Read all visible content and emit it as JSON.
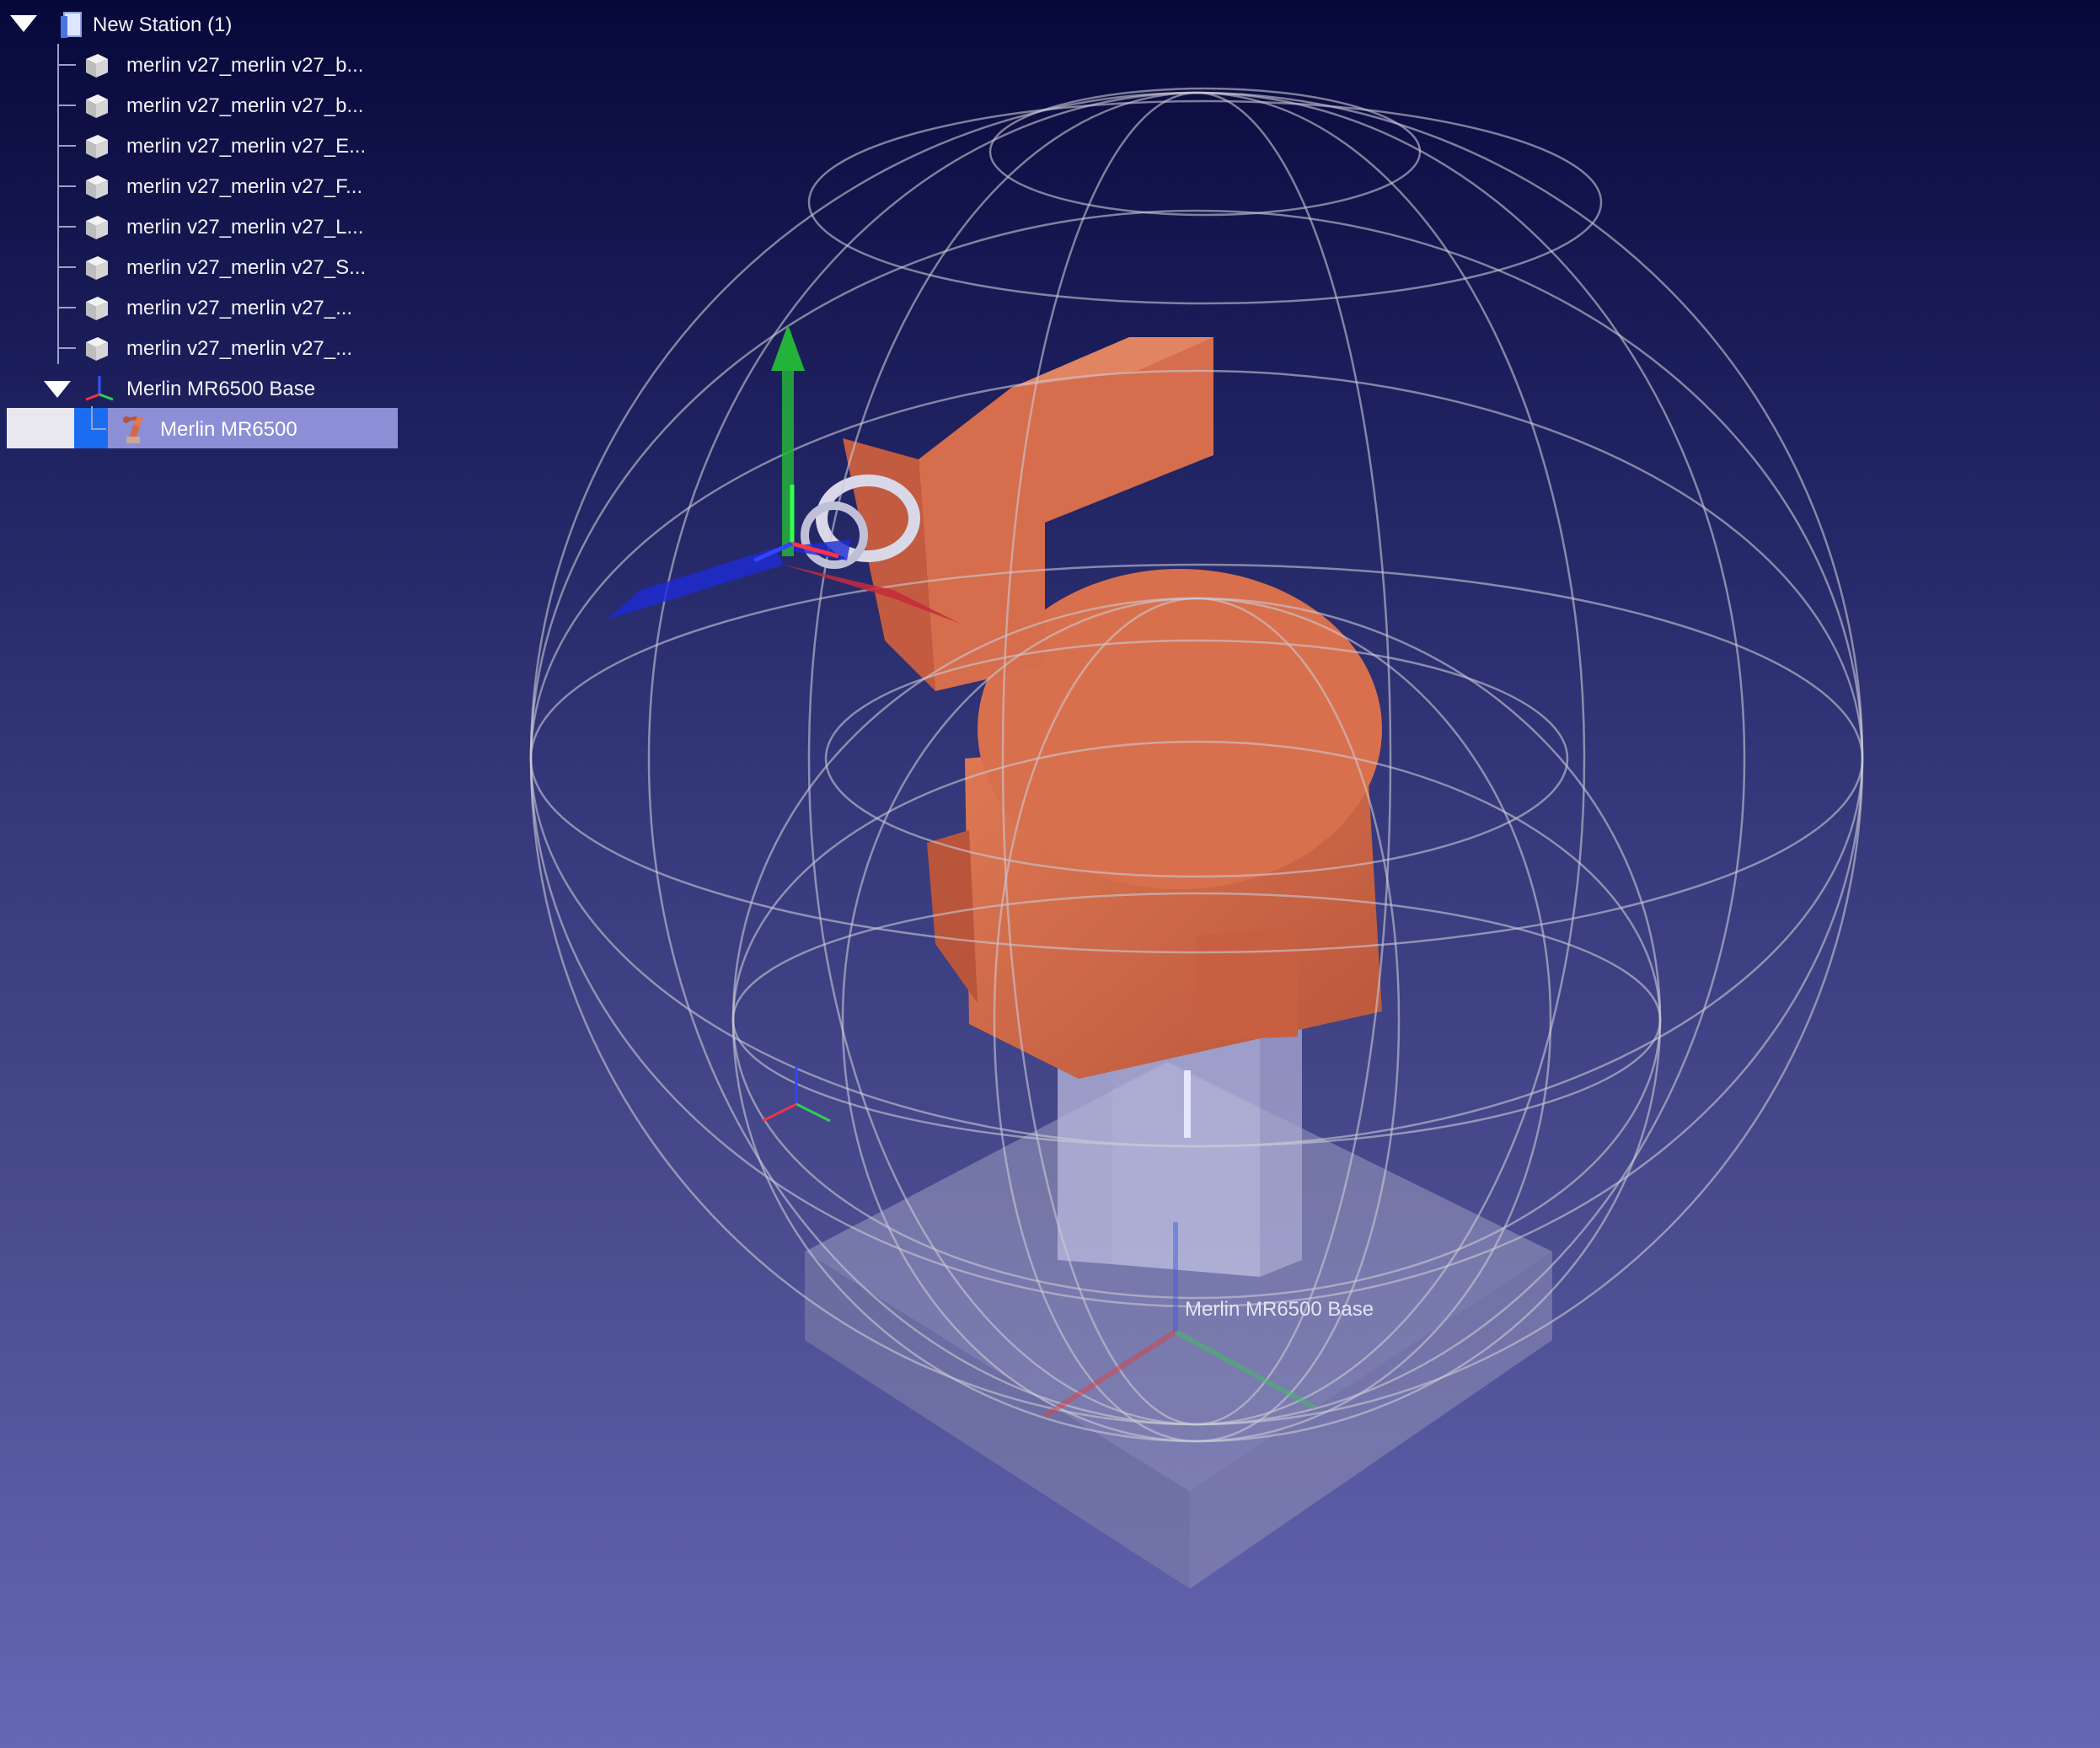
{
  "station": {
    "title": "New Station (1)"
  },
  "parts": [
    {
      "label": "merlin v27_merlin v27_b..."
    },
    {
      "label": "merlin v27_merlin v27_b..."
    },
    {
      "label": "merlin v27_merlin v27_E..."
    },
    {
      "label": "merlin v27_merlin v27_F..."
    },
    {
      "label": "merlin v27_merlin v27_L..."
    },
    {
      "label": "merlin v27_merlin v27_S..."
    },
    {
      "label": "merlin v27_merlin v27_..."
    },
    {
      "label": "merlin v27_merlin v27_..."
    }
  ],
  "frame": {
    "label": "Merlin MR6500 Base"
  },
  "robot": {
    "label": "Merlin MR6500",
    "selected": true
  },
  "scene": {
    "base_label": "Merlin MR6500 Base"
  },
  "colors": {
    "robot": "#d4694a",
    "wireframe": "#c9c9d6",
    "selection": "#8c8fd6",
    "accent": "#1a6df0"
  }
}
